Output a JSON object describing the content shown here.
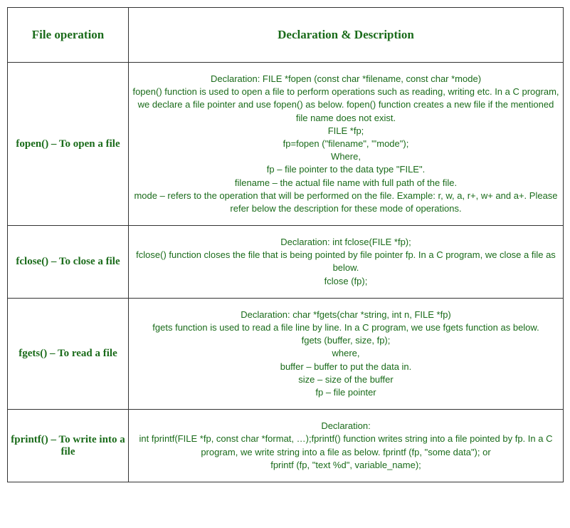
{
  "headers": {
    "col1": "File operation",
    "col2": "Declaration & Description"
  },
  "rows": [
    {
      "operation": "fopen() – To open a file",
      "description_lines": [
        "Declaration: FILE *fopen (const char *filename, const char *mode)",
        "fopen() function is used to open a file to perform operations such as reading, writing etc. In a C program, we declare a file pointer and use fopen() as below. fopen() function creates a new file if the mentioned file name does not exist.",
        "FILE *fp;",
        "fp=fopen (\"filename\", \"'mode\");",
        "Where,",
        "fp – file pointer to the data type \"FILE\".",
        "filename – the actual file name with full path of the file.",
        "mode – refers to the operation that will be performed on the file. Example: r, w, a, r+, w+ and a+. Please refer below the description for these mode of operations."
      ]
    },
    {
      "operation": "fclose() – To close a file",
      "description_lines": [
        "Declaration: int fclose(FILE *fp);",
        "fclose() function closes the file that is being pointed by file pointer fp. In a C program, we close a file as below.",
        "fclose (fp);"
      ]
    },
    {
      "operation": "fgets() – To read a file",
      "description_lines": [
        "Declaration: char *fgets(char *string, int n, FILE *fp)",
        "fgets function is used to read a file line by line. In a C program, we use fgets function as below.",
        "fgets (buffer, size, fp);",
        "where,",
        "buffer – buffer to put the data in.",
        "size – size of the buffer",
        "fp – file pointer"
      ]
    },
    {
      "operation": "fprintf() – To write into a file",
      "description_lines": [
        "Declaration:",
        "int fprintf(FILE *fp, const char *format, …);fprintf() function writes string into a file pointed by fp. In a C program, we write string into a file as below. fprintf (fp, \"some data\"); or",
        "fprintf (fp, \"text %d\", variable_name);"
      ]
    }
  ]
}
